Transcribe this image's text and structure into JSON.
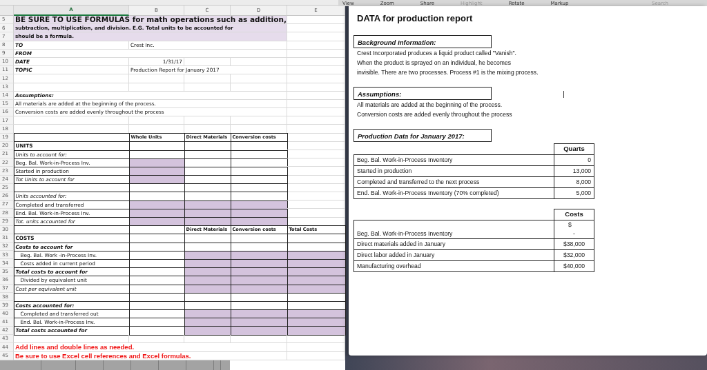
{
  "spreadsheet": {
    "columns": [
      {
        "label": "A",
        "selected": true
      },
      {
        "label": "B",
        "selected": false
      },
      {
        "label": "C",
        "selected": false
      },
      {
        "label": "D",
        "selected": false
      },
      {
        "label": "E",
        "selected": false
      }
    ],
    "rows": [
      {
        "number": "5",
        "label": "BE SURE TO USE FORMULAS for math operations such as addition,",
        "kind": "banner-title",
        "boxed": false
      },
      {
        "number": "6",
        "label": "subtraction, multiplication, and division. E.G. Total units to be accounted for",
        "kind": "banner",
        "boxed": false
      },
      {
        "number": "7",
        "label": "should be a formula.",
        "kind": "banner",
        "boxed": false
      },
      {
        "number": "8",
        "label": "TO",
        "kind": "bold-italic",
        "boxed": false,
        "cells": [
          {
            "text": "Crest Inc.",
            "kind": "text",
            "filled": false
          }
        ]
      },
      {
        "number": "9",
        "label": "FROM",
        "kind": "bold-italic",
        "boxed": false
      },
      {
        "number": "10",
        "label": "DATE",
        "kind": "bold-italic",
        "boxed": false,
        "cells": [
          {
            "text": "1/31/17",
            "kind": "date",
            "filled": false
          }
        ]
      },
      {
        "number": "11",
        "label": "TOPIC",
        "kind": "bold-italic",
        "boxed": false,
        "cells": [
          {
            "text": "Production Report for January 2017",
            "kind": "text",
            "filled": false
          }
        ]
      },
      {
        "number": "12",
        "kind": "plain",
        "boxed": false
      },
      {
        "number": "13",
        "kind": "plain",
        "boxed": false
      },
      {
        "number": "14",
        "label": "Assumptions:",
        "kind": "bold-italic",
        "boxed": false
      },
      {
        "number": "15",
        "label": "All materials are added at the beginning of the process.",
        "kind": "plain",
        "boxed": false
      },
      {
        "number": "16",
        "label": "Conversion costs are added evenly throughout the process",
        "kind": "plain",
        "boxed": false
      },
      {
        "number": "17",
        "kind": "plain",
        "boxed": false
      },
      {
        "number": "18",
        "kind": "plain",
        "boxed": false
      },
      {
        "number": "19",
        "kind": "plain",
        "boxed": true,
        "cells": [
          {
            "text": "Whole Units",
            "kind": "header",
            "filled": false
          },
          {
            "text": "Direct Materials",
            "kind": "header",
            "filled": false
          },
          {
            "text": "Conversion costs",
            "kind": "header",
            "filled": false
          }
        ]
      },
      {
        "number": "20",
        "label": "UNITS",
        "kind": "bold",
        "boxed": true,
        "cells": [
          {
            "filled": false
          },
          {
            "filled": false
          },
          {
            "filled": false
          }
        ]
      },
      {
        "number": "21",
        "label": "Units to account for:",
        "kind": "italic",
        "boxed": true,
        "cells": [
          {
            "filled": false
          },
          {
            "filled": false
          },
          {
            "filled": false
          }
        ]
      },
      {
        "number": "22",
        "label": "Beg. Bal. Work-in-Process Inv.",
        "kind": "plain",
        "boxed": true,
        "cells": [
          {
            "filled": true
          },
          {
            "filled": false
          },
          {
            "filled": false
          }
        ]
      },
      {
        "number": "23",
        "label": "Started in production",
        "kind": "plain",
        "boxed": true,
        "cells": [
          {
            "filled": true
          },
          {
            "filled": false
          },
          {
            "filled": false
          }
        ]
      },
      {
        "number": "24",
        "label": "Tot Units to account for",
        "kind": "italic",
        "boxed": true,
        "cells": [
          {
            "filled": true
          },
          {
            "filled": false
          },
          {
            "filled": false
          }
        ]
      },
      {
        "number": "25",
        "kind": "plain",
        "boxed": true,
        "cells": [
          {
            "filled": false
          },
          {
            "filled": false
          },
          {
            "filled": false
          }
        ]
      },
      {
        "number": "26",
        "label": "Units accounted for:",
        "kind": "italic",
        "boxed": true,
        "cells": [
          {
            "filled": false
          },
          {
            "filled": false
          },
          {
            "filled": false
          }
        ]
      },
      {
        "number": "27",
        "label": "Completed and transferred",
        "kind": "plain",
        "boxed": true,
        "cells": [
          {
            "filled": true
          },
          {
            "filled": true
          },
          {
            "filled": true
          }
        ]
      },
      {
        "number": "28",
        "label": "End. Bal. Work-in-Process Inv.",
        "kind": "plain",
        "boxed": true,
        "cells": [
          {
            "filled": true
          },
          {
            "filled": true
          },
          {
            "filled": true
          }
        ]
      },
      {
        "number": "29",
        "label": "Tot. units accounted for",
        "kind": "italic",
        "boxed": true,
        "cells": [
          {
            "filled": true
          },
          {
            "filled": true
          },
          {
            "filled": true
          }
        ]
      },
      {
        "number": "30",
        "kind": "plain",
        "boxed": true,
        "cells": [
          {
            "filled": false
          },
          {
            "text": "Direct Materials",
            "kind": "header",
            "filled": false
          },
          {
            "text": "Conversion costs",
            "kind": "header",
            "filled": false
          },
          {
            "text": "Total Costs",
            "kind": "header",
            "filled": false
          }
        ]
      },
      {
        "number": "31",
        "label": "COSTS",
        "kind": "bold",
        "boxed": true,
        "cells": [
          {
            "filled": false
          },
          {
            "filled": false
          },
          {
            "filled": false
          },
          {
            "filled": false
          }
        ]
      },
      {
        "number": "32",
        "label": "Costs to account for",
        "kind": "bold-italic",
        "boxed": true,
        "cells": [
          {
            "filled": false
          },
          {
            "filled": false
          },
          {
            "filled": false
          },
          {
            "filled": false
          }
        ]
      },
      {
        "number": "33",
        "label": "Beg. Bal. Work -in-Process Inv.",
        "kind": "indent",
        "boxed": true,
        "cells": [
          {
            "filled": false
          },
          {
            "filled": true
          },
          {
            "filled": true
          },
          {
            "filled": true
          }
        ]
      },
      {
        "number": "34",
        "label": "Costs added in current period",
        "kind": "indent",
        "boxed": true,
        "cells": [
          {
            "filled": false
          },
          {
            "filled": true
          },
          {
            "filled": true
          },
          {
            "filled": true
          }
        ]
      },
      {
        "number": "35",
        "label": "Total  costs to account for",
        "kind": "bold-italic",
        "boxed": true,
        "cells": [
          {
            "filled": false
          },
          {
            "filled": true
          },
          {
            "filled": true
          },
          {
            "filled": true
          }
        ]
      },
      {
        "number": "36",
        "label": "Divided by equivalent unit",
        "kind": "indent",
        "boxed": true,
        "cells": [
          {
            "filled": false
          },
          {
            "filled": true
          },
          {
            "filled": true
          },
          {
            "filled": true
          }
        ]
      },
      {
        "number": "37",
        "label": "Cost per equivalent unit",
        "kind": "italic",
        "boxed": true,
        "cells": [
          {
            "filled": false
          },
          {
            "filled": true
          },
          {
            "filled": true
          },
          {
            "filled": true
          }
        ]
      },
      {
        "number": "38",
        "kind": "plain",
        "boxed": true,
        "cells": [
          {
            "filled": false
          },
          {
            "filled": false
          },
          {
            "filled": false
          },
          {
            "filled": false
          }
        ]
      },
      {
        "number": "39",
        "label": "Costs accounted for:",
        "kind": "bold-italic",
        "boxed": true,
        "cells": [
          {
            "filled": false
          },
          {
            "filled": false
          },
          {
            "filled": false
          },
          {
            "filled": false
          }
        ]
      },
      {
        "number": "40",
        "label": "Completed and transferred out",
        "kind": "indent",
        "boxed": true,
        "cells": [
          {
            "filled": false
          },
          {
            "filled": true
          },
          {
            "filled": true
          },
          {
            "filled": true
          }
        ]
      },
      {
        "number": "41",
        "label": "End. Bal. Work-in-Process Inv.",
        "kind": "indent",
        "boxed": true,
        "cells": [
          {
            "filled": false
          },
          {
            "filled": true
          },
          {
            "filled": true
          },
          {
            "filled": true
          }
        ]
      },
      {
        "number": "42",
        "label": "Total costs accounted for",
        "kind": "bold-italic",
        "boxed": true,
        "cells": [
          {
            "filled": false
          },
          {
            "filled": true
          },
          {
            "filled": true
          },
          {
            "filled": true
          }
        ]
      },
      {
        "number": "43",
        "kind": "plain",
        "boxed": false
      },
      {
        "number": "44",
        "label": "Add lines and double lines as needed.",
        "kind": "red",
        "boxed": false
      },
      {
        "number": "45",
        "label": "Be sure to use Excel cell references and Excel formulas.",
        "kind": "red",
        "boxed": false
      }
    ]
  },
  "viewer": {
    "toolbar": [
      {
        "label": "View",
        "disabled": false
      },
      {
        "label": "Zoom",
        "disabled": false
      },
      {
        "label": "Share",
        "disabled": false
      },
      {
        "label": "Highlight",
        "disabled": true
      },
      {
        "label": "Rotate",
        "disabled": false
      },
      {
        "label": "Markup",
        "disabled": false
      }
    ],
    "search": {
      "placeholder": "Search"
    },
    "title": "DATA for production report",
    "sections": [
      {
        "heading": "Background Information:",
        "lines": [
          "Crest Incorporated produces a liquid product called \"Vanish\".",
          "When the product is sprayed on an individual, he becomes",
          "invisible. There are two processes. Process #1 is the mixing process."
        ]
      },
      {
        "heading": "Assumptions:",
        "lines": [
          "All materials are added at the beginning of the process.",
          "Conversion costs are added evenly throughout the process"
        ]
      },
      {
        "heading": "Production Data for January 2017:"
      }
    ],
    "quarts_table": {
      "header": "Quarts",
      "rows": [
        {
          "label": "Beg. Bal. Work-in-Process Inventory",
          "value": "0"
        },
        {
          "label": "Started in production",
          "value": "13,000"
        },
        {
          "label": "Completed and transferred to the next process",
          "value": "8,000"
        },
        {
          "label": "End. Bal. Work-in-Process Inventory (70% completed)",
          "value": "5,000"
        }
      ]
    },
    "costs_table": {
      "header": "Costs",
      "rows": [
        {
          "label": "Beg. Bal. Work-in-Process Inventory",
          "currency": "$",
          "value": "-"
        },
        {
          "label": "Direct materials added in January",
          "value": "$38,000"
        },
        {
          "label": "Direct labor added in January",
          "value": "$32,000"
        },
        {
          "label": "Manufacturing overhead",
          "value": "$40,000"
        }
      ]
    }
  }
}
